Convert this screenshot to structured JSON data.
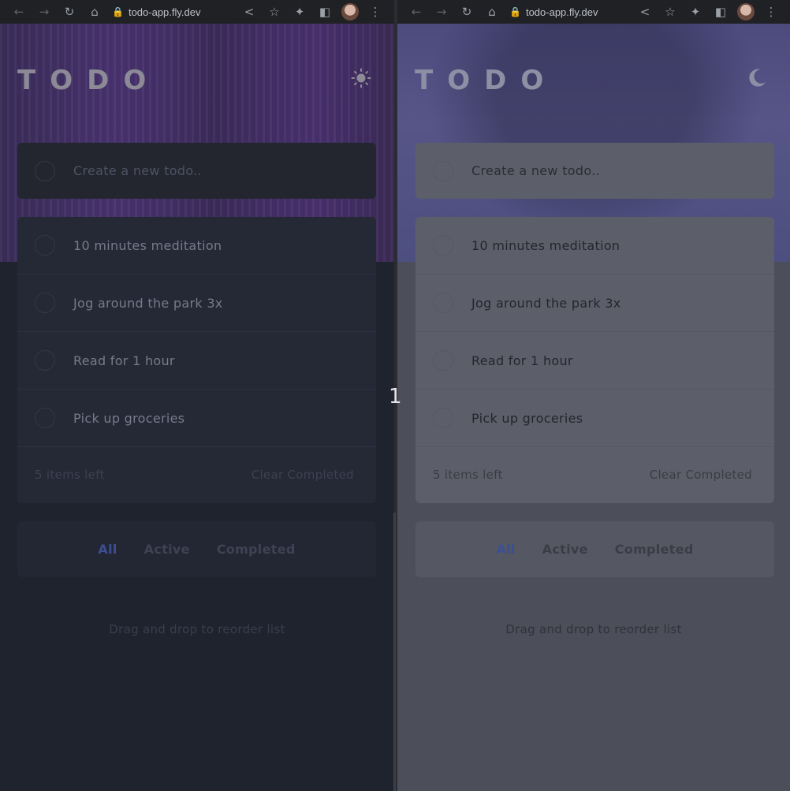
{
  "browser": {
    "url": "todo-app.fly.dev"
  },
  "app": {
    "logo": "TODO",
    "new_todo_placeholder": "Create a new todo..",
    "items": [
      {
        "label": "10 minutes meditation"
      },
      {
        "label": "Jog around the park 3x"
      },
      {
        "label": "Read for 1 hour"
      },
      {
        "label": "Pick up groceries"
      }
    ],
    "items_left": "5 items left",
    "clear_completed": "Clear Completed",
    "filters": [
      "All",
      "Active",
      "Completed"
    ],
    "active_filter": "All",
    "hint": "Drag and drop to reorder list"
  },
  "theme_icons": {
    "left": "sun-icon",
    "right": "moon-icon"
  },
  "overlay_label": "1",
  "colors": {
    "accent_active_filter": "#3b4f92",
    "dark_background": "#1f232e",
    "light_background_dimmed": "#4c4f59"
  }
}
